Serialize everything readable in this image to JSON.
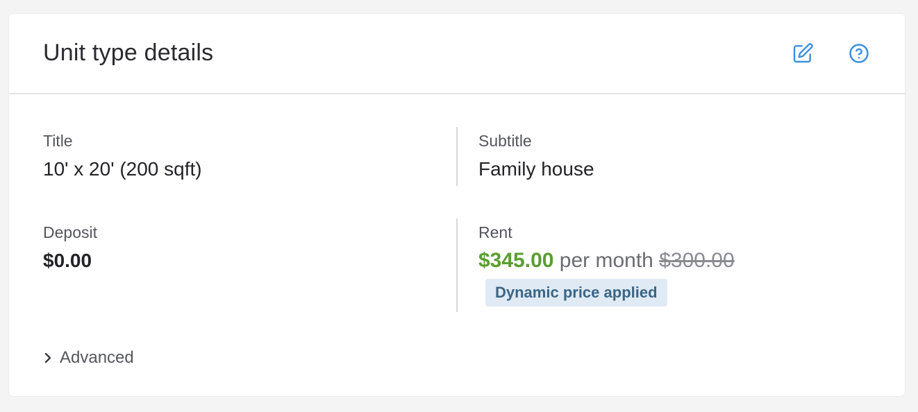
{
  "card": {
    "title": "Unit type details",
    "edit_icon": "edit-pencil-icon",
    "help_icon": "help-circle-icon",
    "accent_color": "#3b8fe0"
  },
  "fields": {
    "title": {
      "label": "Title",
      "value": "10' x 20' (200 sqft)"
    },
    "subtitle": {
      "label": "Subtitle",
      "value": "Family house"
    },
    "deposit": {
      "label": "Deposit",
      "value": "$0.00"
    },
    "rent": {
      "label": "Rent",
      "price": "$345.00",
      "unit": "per month",
      "original_price": "$300.00",
      "badge": "Dynamic price applied",
      "price_color": "#5a9e2f"
    }
  },
  "advanced": {
    "label": "Advanced",
    "icon": "chevron-right-icon"
  }
}
